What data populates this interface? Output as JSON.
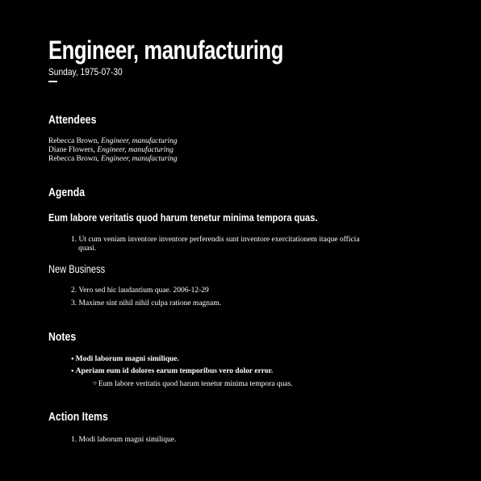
{
  "header": {
    "title": "Engineer, manufacturing",
    "date": "Sunday, 1975-07-30"
  },
  "attendees": {
    "heading": "Attendees",
    "list": [
      {
        "name": "Rebecca Brown",
        "sep": ", ",
        "role": "Engineer, manufacturing"
      },
      {
        "name": "Diane Flowers",
        "sep": ", ",
        "role": "Engineer, manufacturing"
      },
      {
        "name": "Rebecca Brown",
        "sep": ", ",
        "role": "Engineer, manufacturing"
      }
    ]
  },
  "agenda": {
    "heading": "Agenda",
    "topic": "Eum labore veritatis quod harum tenetur minima tempora quas.",
    "items": [
      {
        "num": "1.",
        "text_line1": "Ut cum veniam inventore inventore perferendis sunt inventore exercitationem itaque officia",
        "text_line2": "quasi."
      }
    ],
    "subheading": "New Business",
    "new_business": [
      {
        "num": "2.",
        "text": "Vero sed hic laudantium quae. 2006-12-29"
      },
      {
        "num": "3.",
        "text": "Maxime sint nihil nihil culpa ratione magnam."
      }
    ]
  },
  "notes": {
    "heading": "Notes",
    "items": [
      "Modi laborum magni similique.",
      "Aperiam eum id dolores earum temporibus vero dolor error."
    ],
    "subitems": [
      "Eum labore veritatis quod harum tenetur minima tempora quas."
    ]
  },
  "action_items": {
    "heading": "Action Items",
    "items": [
      {
        "num": "1.",
        "text": "Modi laborum magni similique."
      }
    ]
  }
}
